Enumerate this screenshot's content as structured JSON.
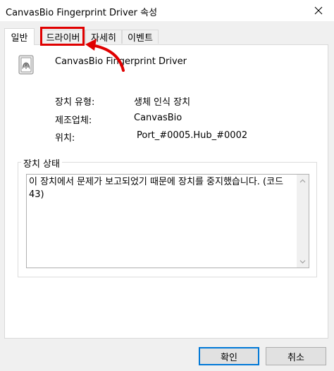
{
  "window": {
    "title": "CanvasBio Fingerprint Driver 속성"
  },
  "tabs": [
    {
      "label": "일반",
      "active": true
    },
    {
      "label": "드라이버",
      "active": false
    },
    {
      "label": "자세히",
      "active": false
    },
    {
      "label": "이벤트",
      "active": false
    }
  ],
  "device": {
    "name": "CanvasBio Fingerprint Driver",
    "icon": "fingerprint-reader-icon"
  },
  "properties": [
    {
      "label": "장치 유형:",
      "value": "생체 인식 장치"
    },
    {
      "label": "제조업체:",
      "value": "CanvasBio"
    },
    {
      "label": "위치:",
      "value": "Port_#0005.Hub_#0002"
    }
  ],
  "status": {
    "group_title": "장치 상태",
    "text": "이 장치에서 문제가 보고되었기 때문에 장치를 중지했습니다. (코드 43)"
  },
  "buttons": {
    "ok": "확인",
    "cancel": "취소"
  },
  "annotation": {
    "highlight_color": "#e00000"
  }
}
